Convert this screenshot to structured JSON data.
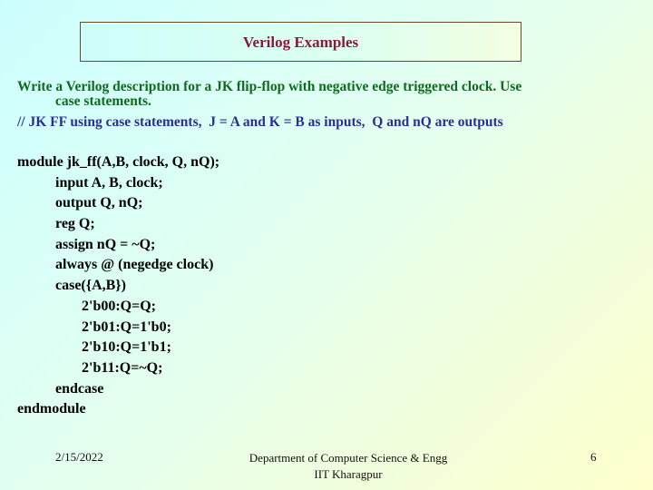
{
  "slide": {
    "title": "Verilog Examples",
    "problem": {
      "line1": "Write a Verilog description for a  JK flip-flop with negative edge triggered clock. Use",
      "line2": "case statements."
    },
    "comment": "// JK FF using case statements,  J = A and K = B as inputs,  Q and nQ are outputs",
    "code": [
      {
        "indent": 0,
        "text": "module jk_ff(A,B, clock, Q, nQ);"
      },
      {
        "indent": 1,
        "text": "input A, B, clock;"
      },
      {
        "indent": 1,
        "text": "output Q, nQ;"
      },
      {
        "indent": 1,
        "text": "reg Q;"
      },
      {
        "indent": 1,
        "text": "assign nQ = ~Q;"
      },
      {
        "indent": 1,
        "text": "always @ (negedge clock)"
      },
      {
        "indent": 1,
        "text": "case({A,B})"
      },
      {
        "indent": 2,
        "text": "2'b00:Q=Q;"
      },
      {
        "indent": 2,
        "text": "2'b01:Q=1'b0;"
      },
      {
        "indent": 2,
        "text": "2'b10:Q=1'b1;"
      },
      {
        "indent": 2,
        "text": "2'b11:Q=~Q;"
      },
      {
        "indent": 1,
        "text": "endcase"
      },
      {
        "indent": 0,
        "text": "endmodule"
      }
    ]
  },
  "footer": {
    "date": "2/15/2022",
    "department_line1": "Department of Computer Science & Engg",
    "department_line2": "IIT Kharagpur",
    "page_number": "6"
  },
  "colors": {
    "title": "#8b1a3a",
    "problem_text": "#0f6b1e",
    "comment_text": "#2b2f92",
    "code_text": "#000000"
  }
}
